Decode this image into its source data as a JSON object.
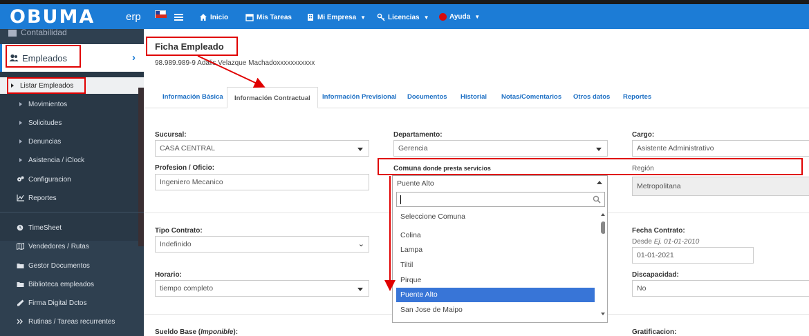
{
  "app": {
    "logo_text": "OBUMA",
    "logo_suffix": "erp"
  },
  "nav": {
    "items": [
      {
        "label": "Inicio",
        "icon": "home-icon"
      },
      {
        "label": "Mis Tareas",
        "icon": "calendar-icon"
      },
      {
        "label": "Mi Empresa",
        "icon": "building-icon"
      },
      {
        "label": "Licencias",
        "icon": "key-icon"
      },
      {
        "label": "Ayuda",
        "icon": "help-icon"
      }
    ]
  },
  "sidebar": {
    "prev_item": "Contabilidad",
    "active": "Empleados",
    "sub_items": [
      "Listar Empleados",
      "Movimientos",
      "Solicitudes",
      "Denuncias",
      "Asistencia / iClock"
    ],
    "main_items": [
      "Configuracion",
      "Reportes"
    ],
    "lower_items": [
      "TimeSheet",
      "Vendedores / Rutas",
      "Gestor Documentos",
      "Biblioteca empleados",
      "Firma Digital Dctos",
      "Rutinas / Tareas recurrentes"
    ]
  },
  "page": {
    "title": "Ficha Empleado",
    "subtitle": "98.989.989-9 Adalis Velazque Machadoxxxxxxxxxxx",
    "tabs": [
      "Información Básica",
      "Información Contractual",
      "Información Previsional",
      "Documentos",
      "Historial",
      "Notas/Comentarios",
      "Otros datos",
      "Reportes"
    ]
  },
  "form": {
    "sucursal_label": "Sucursal:",
    "sucursal_value": "CASA CENTRAL",
    "departamento_label": "Departamento:",
    "departamento_value": "Gerencia",
    "cargo_label": "Cargo:",
    "cargo_value": "Asistente Administrativo",
    "profesion_label": "Profesion / Oficio:",
    "profesion_value": "Ingeniero Mecanico",
    "comuna_label": "Comuna",
    "comuna_label_suffix": "donde presta servicios",
    "comuna_value": "Puente Alto",
    "region_label": "Región",
    "region_value": "Metropolitana",
    "tipo_contrato_label": "Tipo Contrato:",
    "tipo_contrato_value": "Indefinido",
    "fecha_contrato_label": "Fecha Contrato:",
    "fecha_hint_prefix": "Desde",
    "fecha_hint_example": "Ej. 01-01-2010",
    "fecha_contrato_value": "01-01-2021",
    "horario_label": "Horario:",
    "horario_value": "tiempo completo",
    "discapacidad_label": "Discapacidad:",
    "discapacidad_value": "No",
    "sueldo_label": "Sueldo Base (",
    "sueldo_label_em": "Imponible",
    "sueldo_label_end": "):",
    "gratificacion_label": "Gratificacion:"
  },
  "comuna_dropdown": {
    "search_value": "",
    "options": [
      "Seleccione Comuna",
      "Colina",
      "Lampa",
      "Tiltil",
      "Pirque",
      "Puente Alto",
      "San Jose de Maipo"
    ],
    "highlighted": "Puente Alto"
  },
  "colors": {
    "brand": "#1c7cd6",
    "sidebar": "#2f4050",
    "annotation": "#e00000",
    "highlight": "#3875d7"
  }
}
